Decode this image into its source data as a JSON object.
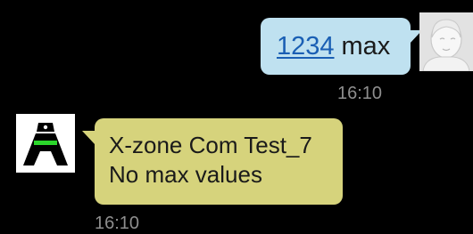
{
  "messages": {
    "sent": {
      "link_text": "1234",
      "text": "max",
      "time": "16:10",
      "bubble_color": "#bfe1f0",
      "link_color": "#1a5fb4",
      "avatar_icon": "default-contact-avatar-icon"
    },
    "received": {
      "line1": "X-zone Com Test_7",
      "line2": "No max values",
      "time": "16:10",
      "bubble_color": "#d6d37c",
      "avatar_icon": "x-zone-device-logo-icon"
    }
  },
  "colors": {
    "background": "#000000",
    "timestamp": "#8e8e8e"
  }
}
